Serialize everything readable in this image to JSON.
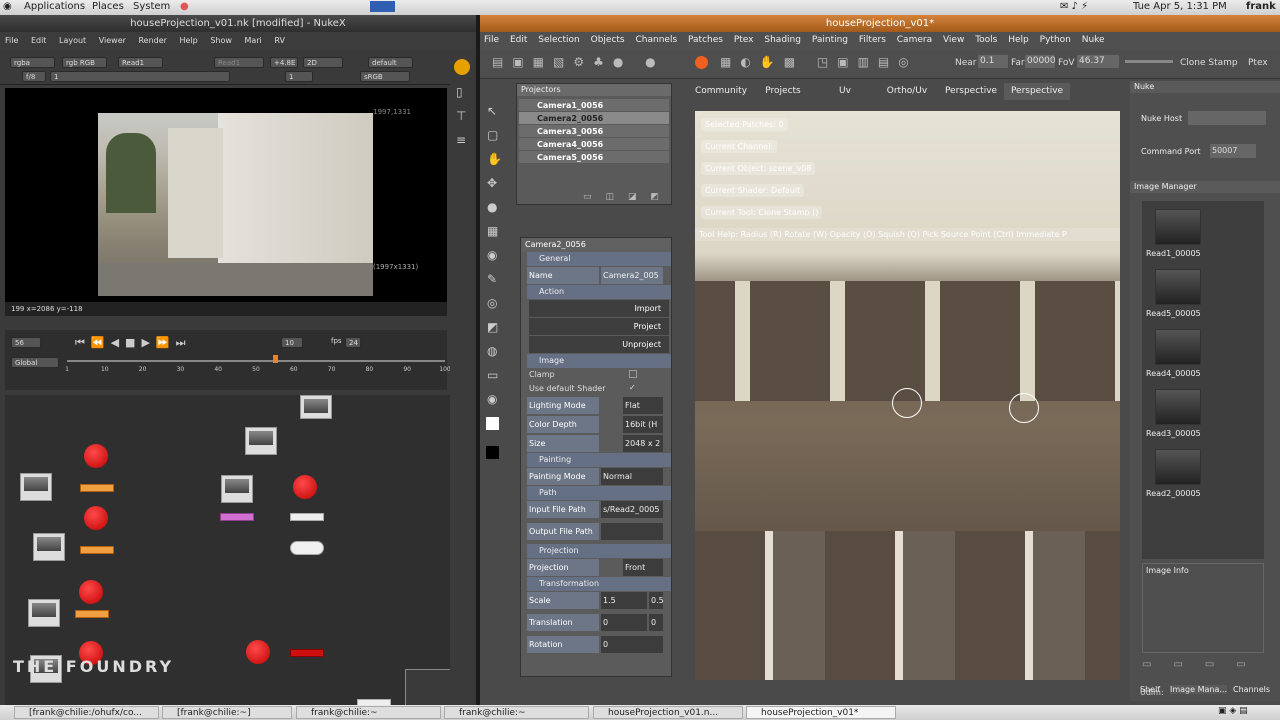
{
  "topbar": {
    "apps": "Applications",
    "places": "Places",
    "system": "System",
    "clock": "Tue Apr  5,  1:31 PM",
    "user": "frank"
  },
  "nuke": {
    "title": "houseProjection_v01.nk [modified] - NukeX",
    "menu": [
      "File",
      "Edit",
      "Layout",
      "Viewer",
      "Render",
      "Help",
      "Show",
      "Mari",
      "RV"
    ],
    "toolbar": {
      "channels": "rgba",
      "rgb": "rgb RGB",
      "a_input": "Read1",
      "b_input": "Read1",
      "exposure": "+4.8E",
      "view": "2D",
      "lut": "default",
      "fstop": "f/8",
      "frame_in": "1",
      "colorspace": "sRGB",
      "one": "1"
    },
    "viewer": {
      "format_top": "1997,1331",
      "format_bottom": "(1997x1331)",
      "info": "199  x=2086 y=-118"
    },
    "timeline": {
      "frame": "56",
      "fps_label": "fps",
      "fps": "24",
      "step": "10",
      "mode": "Global",
      "ticks": [
        "1",
        "10",
        "20",
        "30",
        "40",
        "50",
        "60",
        "70",
        "80",
        "90",
        "100"
      ]
    },
    "logo": "THE FOUNDRY"
  },
  "mari": {
    "title": "houseProjection_v01*",
    "menu": [
      "File",
      "Edit",
      "Selection",
      "Objects",
      "Channels",
      "Patches",
      "Ptex",
      "Shading",
      "Painting",
      "Filters",
      "Camera",
      "View",
      "Tools",
      "Help",
      "Python",
      "Nuke"
    ],
    "toolbar": {
      "near_label": "Near",
      "near": "0.1",
      "far_label": "Far",
      "far": "00000",
      "fov_label": "FoV",
      "fov": "46.37",
      "clone": "Clone Stamp",
      "ptex": "Ptex"
    },
    "projectors": {
      "title": "Projectors",
      "cameras": [
        "Camera1_0056",
        "Camera2_0056",
        "Camera3_0056",
        "Camera4_0056",
        "Camera5_0056"
      ],
      "selected": 1
    },
    "props": {
      "title": "Camera2_0056",
      "general": "General",
      "name_label": "Name",
      "name_value": "Camera2_005",
      "action": "Action",
      "import": "Import",
      "project": "Project",
      "unproject": "Unproject",
      "image": "Image",
      "clamp": "Clamp",
      "use_default": "Use default Shader",
      "lighting_label": "Lighting Mode",
      "lighting": "Flat",
      "depth_label": "Color Depth",
      "depth": "16bit (H",
      "size_label": "Size",
      "size": "2048 x 2",
      "painting": "Painting",
      "painting_mode_label": "Painting Mode",
      "painting_mode": "Normal",
      "path": "Path",
      "input_label": "Input File Path",
      "input": "s/Read2_0005",
      "output_label": "Output File Path",
      "projection": "Projection",
      "proj_label": "Projection",
      "proj": "Front",
      "transformation": "Transformation",
      "scale_label": "Scale",
      "scale": "1.5",
      "scale2": "0.5",
      "translation_label": "Translation",
      "translation": "0",
      "translation2": "0",
      "rotation_label": "Rotation",
      "rotation": "0"
    },
    "tabs": [
      "Community",
      "Projects",
      "Uv",
      "Ortho/Uv",
      "Perspective",
      "Perspective"
    ],
    "hud": {
      "patches": "Selected Patches: 0",
      "channel": "Current Channel:",
      "object": "Current Object: scene_v08",
      "shader": "Current Shader: Default",
      "tool": "Current Tool: Clone Stamp ()",
      "help": "Tool Help:   Radius (R)  Rotate (W)  Opacity (O)  Squish (Q)  Pick Source Point (Ctrl)  Immediate P"
    },
    "right": {
      "nuke_title": "Nuke",
      "nuke_host": "Nuke Host",
      "command_port": "Command Port",
      "port": "50007",
      "im_title": "Image Manager",
      "images": [
        "Read1_00005",
        "Read5_00005",
        "Read4_00005",
        "Read3_00005",
        "Read2_00005"
      ],
      "image_info": "Image Info",
      "tabs": [
        "Shelf",
        "Image Mana...",
        "Channels"
      ],
      "udim": "Udim:"
    }
  },
  "taskbar": [
    "[frank@chilie:/ohufx/co...",
    "[frank@chilie:~]",
    "frank@chilie:~",
    "frank@chilie:~",
    "houseProjection_v01.n...",
    "houseProjection_v01*"
  ],
  "colors": {
    "mari_title": "#c8742e",
    "node_red": "#e01010",
    "node_orange": "#f0a040",
    "section": "#667084"
  }
}
